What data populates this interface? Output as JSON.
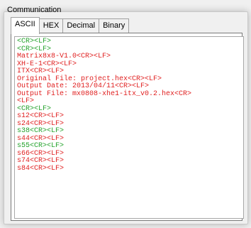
{
  "group": {
    "label": "Communication"
  },
  "tabs": [
    {
      "label": "ASCII",
      "active": true
    },
    {
      "label": "HEX",
      "active": false
    },
    {
      "label": "Decimal",
      "active": false
    },
    {
      "label": "Binary",
      "active": false
    }
  ],
  "terminal": {
    "colors": {
      "green": "#22a22a",
      "red": "#e02020"
    },
    "lines": [
      {
        "text": "<CR><LF>",
        "color": "green"
      },
      {
        "text": "<CR><LF>",
        "color": "green"
      },
      {
        "text": "Matrix8x8-V1.0<CR><LF>",
        "color": "red"
      },
      {
        "text": "XH-E-1<CR><LF>",
        "color": "red"
      },
      {
        "text": "ITX<CR><LF>",
        "color": "red"
      },
      {
        "text": "Original File: project.hex<CR><LF>",
        "color": "red"
      },
      {
        "text": "Output Date: 2013/04/11<CR><LF>",
        "color": "red"
      },
      {
        "text": "Output File: mx0808-xhe1-itx_v0.2.hex<CR>",
        "color": "red"
      },
      {
        "text": "<LF>",
        "color": "red"
      },
      {
        "text": "<CR><LF>",
        "color": "green"
      },
      {
        "text": "s12<CR><LF>",
        "color": "red"
      },
      {
        "text": "s24<CR><LF>",
        "color": "red"
      },
      {
        "text": "s38<CR><LF>",
        "color": "green"
      },
      {
        "text": "s44<CR><LF>",
        "color": "red"
      },
      {
        "text": "s55<CR><LF>",
        "color": "green"
      },
      {
        "text": "s66<CR><LF>",
        "color": "red"
      },
      {
        "text": "s74<CR><LF>",
        "color": "red"
      },
      {
        "text": "s84<CR><LF>",
        "color": "red"
      }
    ]
  }
}
